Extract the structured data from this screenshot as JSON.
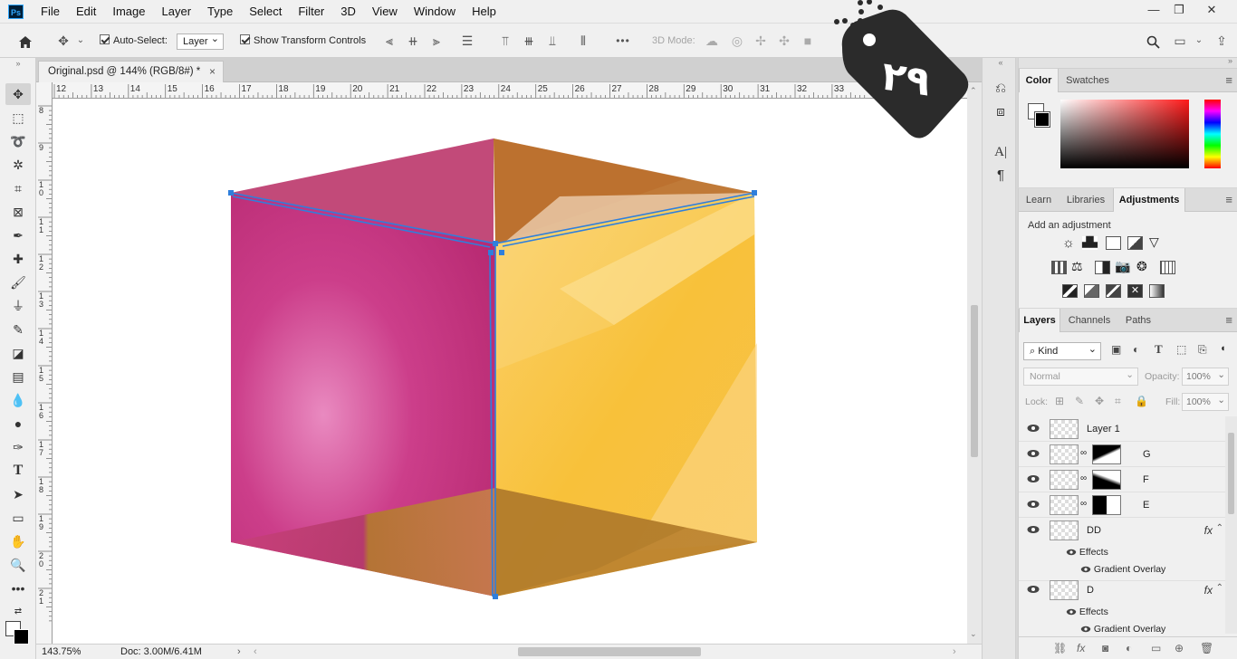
{
  "app": {
    "logo": "Ps"
  },
  "menu": [
    "File",
    "Edit",
    "Image",
    "Layer",
    "Type",
    "Select",
    "Filter",
    "3D",
    "View",
    "Window",
    "Help"
  ],
  "window_controls": {
    "minimize": "—",
    "restore": "❐",
    "close": "✕"
  },
  "options": {
    "auto_select_label": "Auto-Select:",
    "auto_select_value": "Layer",
    "show_transform_label": "Show Transform Controls",
    "mode_3d_label": "3D Mode:",
    "more": "•••"
  },
  "badge": {
    "text": "۲۹",
    "color": "#2b2b2b"
  },
  "document": {
    "tab_title": "Original.psd @ 144% (RGB/8#) *",
    "close": "×",
    "ruler_top": [
      "12",
      "13",
      "14",
      "15",
      "16",
      "17",
      "18",
      "19",
      "20",
      "21",
      "22",
      "23",
      "24",
      "25",
      "26",
      "27",
      "28",
      "29",
      "30",
      "31",
      "32",
      "33"
    ],
    "ruler_left": [
      "8",
      "9",
      "1\n0",
      "1\n1",
      "1\n2",
      "1\n3",
      "1\n4",
      "1\n5",
      "1\n6",
      "1\n7",
      "1\n8",
      "1\n9",
      "2\n0",
      "2\n1"
    ],
    "zoom": "143.75%",
    "doc_size": "Doc: 3.00M/6.41M"
  },
  "color_panel": {
    "tabs": [
      "Color",
      "Swatches"
    ],
    "active": "Color",
    "hue_color": "#ff1a1a"
  },
  "adjust_panel": {
    "tabs": [
      "Learn",
      "Libraries",
      "Adjustments"
    ],
    "active": "Adjustments",
    "hint": "Add an adjustment"
  },
  "layers_panel": {
    "tabs": [
      "Layers",
      "Channels",
      "Paths"
    ],
    "active": "Layers",
    "filter_kind": "Kind",
    "blend_mode": "Normal",
    "opacity_label": "Opacity:",
    "opacity_value": "100%",
    "lock_label": "Lock:",
    "fill_label": "Fill:",
    "fill_value": "100%",
    "layers": [
      {
        "name": "Layer 1"
      },
      {
        "name": "G"
      },
      {
        "name": "F"
      },
      {
        "name": "E"
      },
      {
        "name": "DD",
        "fx": "fx",
        "effects": "Effects",
        "effect": "Gradient Overlay"
      },
      {
        "name": "D",
        "fx": "fx",
        "effects": "Effects",
        "effect": "Gradient Overlay"
      }
    ]
  },
  "colors": {
    "magenta": "#c2307a",
    "yellow": "#f8c23a",
    "selection": "#2f7fdc",
    "accent_panel": "#f0f0f0"
  }
}
